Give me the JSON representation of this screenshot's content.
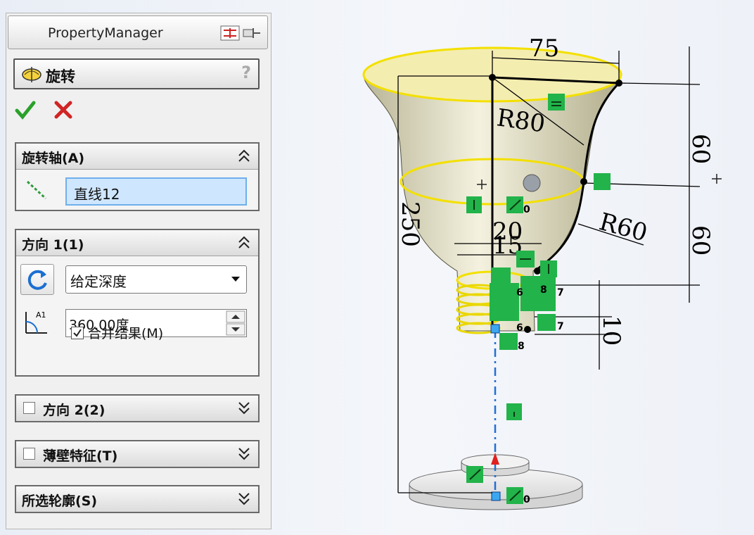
{
  "property_manager": {
    "title": "PropertyManager",
    "feature_title": "旋转",
    "help_glyph": "?",
    "groups": {
      "axis": {
        "title": "旋转轴(A)",
        "value": "直线12"
      },
      "direction1": {
        "title": "方向 1(1)",
        "end_condition": "给定深度",
        "angle": "360.00度",
        "merge_label": "合并结果(M)",
        "merge_checked": true
      },
      "direction2": {
        "title": "方向 2(2)",
        "checked": false
      },
      "thin": {
        "title": "薄壁特征(T)",
        "checked": false
      },
      "contours": {
        "title": "所选轮廓(S)"
      }
    }
  },
  "sketch": {
    "dimensions": {
      "d75": "75",
      "r80": "R80",
      "d60a": "60",
      "d250": "250",
      "d20": "20",
      "d15": "15",
      "r60": "R60",
      "d60b": "60",
      "d10": "10"
    },
    "relation_counts": [
      "0",
      "6",
      "7",
      "8",
      "6",
      "7",
      "8",
      "0"
    ]
  },
  "colors": {
    "accent": "#0a64d8",
    "relation_green": "#22b34a",
    "silhouette_yellow": "#f3e000"
  }
}
